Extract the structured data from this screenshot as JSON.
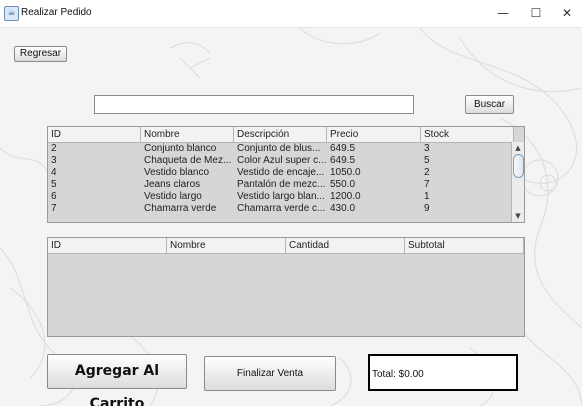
{
  "window": {
    "title": "Realizar Pedido",
    "controls": {
      "minimize": "—",
      "maximize": "☐",
      "close": "✕"
    }
  },
  "toolbar": {
    "back_label": "Regresar",
    "search_value": "",
    "search_label": "Buscar"
  },
  "products_table": {
    "columns": [
      "ID",
      "Nombre",
      "Descripción",
      "Precio",
      "Stock"
    ],
    "rows": [
      [
        "2",
        "Conjunto blanco",
        "Conjunto de blus...",
        "649.5",
        "3"
      ],
      [
        "3",
        "Chaqueta de Mez...",
        "Color Azul super c...",
        "649.5",
        "5"
      ],
      [
        "4",
        "Vestido blanco",
        "Vestido de encaje...",
        "1050.0",
        "2"
      ],
      [
        "5",
        "Jeans claros",
        "Pantalón de mezc...",
        "550.0",
        "7"
      ],
      [
        "6",
        "Vestido largo",
        "Vestido largo blan...",
        "1200.0",
        "1"
      ],
      [
        "7",
        "Chamarra verde",
        "Chamarra verde c...",
        "430.0",
        "9"
      ]
    ]
  },
  "cart_table": {
    "columns": [
      "ID",
      "Nombre",
      "Cantidad",
      "Subtotal"
    ],
    "rows": []
  },
  "actions": {
    "add_to_cart": "Agregar Al Carrito",
    "finalize": "Finalizar Venta"
  },
  "total": {
    "label": "Total: $0.00"
  }
}
